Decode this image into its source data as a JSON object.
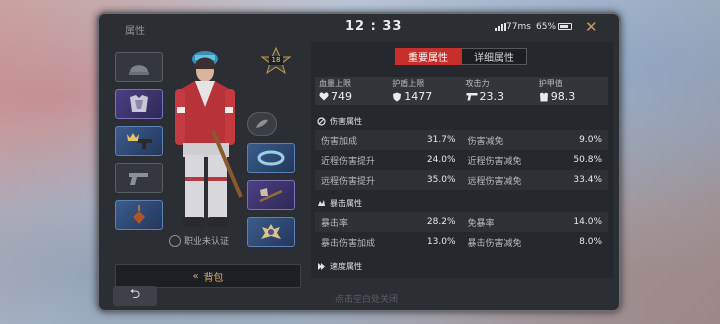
{
  "header": {
    "title": "属性",
    "clock": "12 : 33",
    "ping": "77ms",
    "battery": "65%",
    "close": "✕"
  },
  "loadout": {
    "rank_level": "18",
    "cert_label": "职业未认证",
    "bag_label": "背包",
    "bag_arrow": "«"
  },
  "tabs": [
    {
      "label": "重要属性",
      "active": true
    },
    {
      "label": "详细属性",
      "active": false
    }
  ],
  "stats": [
    {
      "label": "血量上限",
      "value": "749",
      "icon": "heart-icon"
    },
    {
      "label": "护盾上限",
      "value": "1477",
      "icon": "shield-icon"
    },
    {
      "label": "攻击力",
      "value": "23.3",
      "icon": "gun-icon"
    },
    {
      "label": "护甲值",
      "value": "98.3",
      "icon": "armor-icon"
    }
  ],
  "sections": [
    {
      "title": "伤害属性",
      "rows": [
        [
          {
            "k": "伤害加成",
            "v": "31.7%"
          },
          {
            "k": "伤害减免",
            "v": "9.0%"
          }
        ],
        [
          {
            "k": "近程伤害提升",
            "v": "24.0%"
          },
          {
            "k": "近程伤害减免",
            "v": "50.8%"
          }
        ],
        [
          {
            "k": "远程伤害提升",
            "v": "35.0%"
          },
          {
            "k": "远程伤害减免",
            "v": "33.4%"
          }
        ]
      ]
    },
    {
      "title": "暴击属性",
      "rows": [
        [
          {
            "k": "暴击率",
            "v": "28.2%"
          },
          {
            "k": "免暴率",
            "v": "14.0%"
          }
        ],
        [
          {
            "k": "暴击伤害加成",
            "v": "13.0%"
          },
          {
            "k": "暴击伤害减免",
            "v": "8.0%"
          }
        ]
      ]
    },
    {
      "title": "速度属性",
      "rows": []
    }
  ],
  "footer": {
    "back": "⮌",
    "hint": "点击空白处关闭"
  },
  "colors": {
    "accent": "#c62f2a",
    "gold": "#d3b37a",
    "panel": "#2b2e33"
  }
}
